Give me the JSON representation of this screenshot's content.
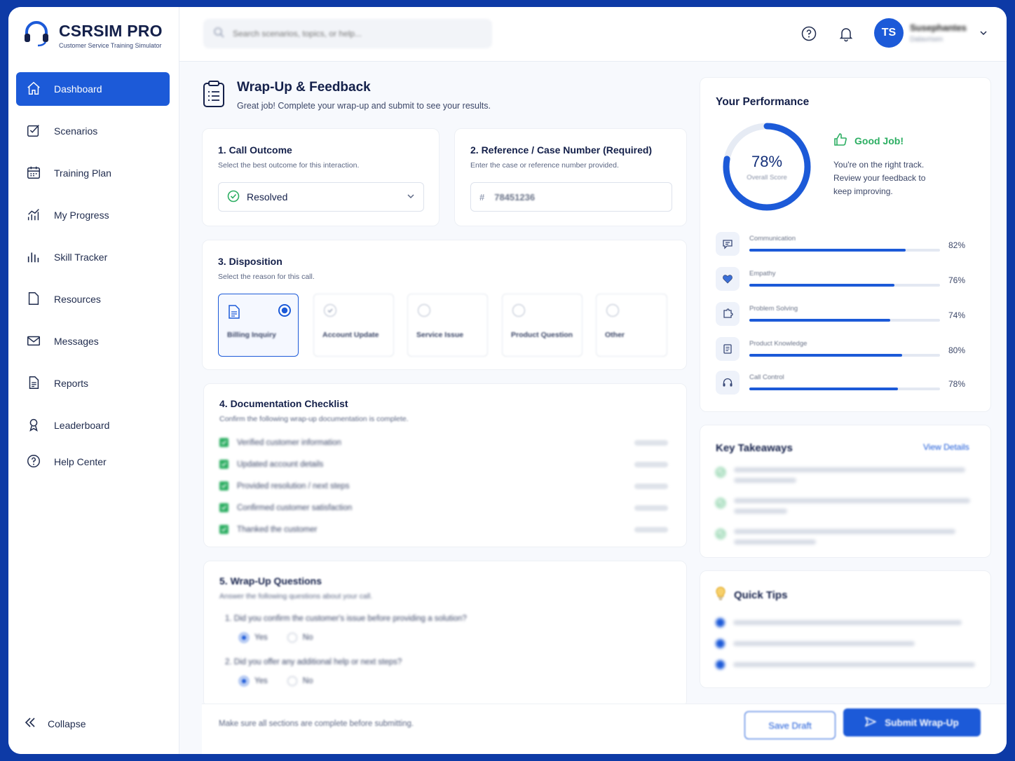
{
  "app": {
    "brand_title": "CSRSIM PRO",
    "brand_subtitle": "Customer Service Training Simulator"
  },
  "sidebar": {
    "items": [
      {
        "label": "Dashboard",
        "icon": "home-icon",
        "active": true
      },
      {
        "label": "Scenarios",
        "icon": "scenarios-icon"
      },
      {
        "label": "Training Plan",
        "icon": "calendar-icon"
      },
      {
        "label": "My Progress",
        "icon": "progress-icon"
      },
      {
        "label": "Skill Tracker",
        "icon": "bar-chart-icon"
      },
      {
        "label": "Resources",
        "icon": "folder-icon"
      },
      {
        "label": "Messages",
        "icon": "mail-icon"
      },
      {
        "label": "Reports",
        "icon": "report-icon"
      },
      {
        "label": "Leaderboard",
        "icon": "trophy-icon"
      },
      {
        "label": "Help Center",
        "icon": "help-icon"
      }
    ],
    "collapse_label": "Collapse"
  },
  "topbar": {
    "search_placeholder": "Search scenarios, topics, or help...",
    "avatar_initials": "TS",
    "user_name": "Susephantes",
    "user_role": "Dalavrisen"
  },
  "page": {
    "title": "Wrap-Up & Feedback",
    "subtitle": "Great job! Complete your wrap-up and submit to see your results."
  },
  "call_outcome": {
    "title": "1. Call Outcome",
    "hint": "Select the best outcome for this interaction.",
    "selected": "Resolved"
  },
  "reference": {
    "title": "2. Reference / Case Number (Required)",
    "hint": "Enter the case or reference number provided.",
    "value": "78451236"
  },
  "disposition": {
    "title": "3. Disposition",
    "hint": "Select the reason for this call.",
    "options": [
      {
        "label": "Billing Inquiry",
        "selected": true
      },
      {
        "label": "Account Update"
      },
      {
        "label": "Service Issue"
      },
      {
        "label": "Product Question"
      },
      {
        "label": "Other"
      }
    ]
  },
  "checklist": {
    "title": "4. Documentation Checklist",
    "hint": "Confirm the following wrap-up documentation is complete.",
    "items": [
      "Verified customer information",
      "Updated account details",
      "Provided resolution / next steps",
      "Confirmed customer satisfaction",
      "Thanked the customer"
    ]
  },
  "questions": {
    "title": "5. Wrap-Up Questions",
    "hint": "Answer the following questions about your call.",
    "items": [
      {
        "text": "1.  Did you confirm the customer's issue before providing a solution?",
        "yes": "Yes",
        "no": "No",
        "answer": "Yes"
      },
      {
        "text": "2.  Did you offer any additional help or next steps?",
        "yes": "Yes",
        "no": "No",
        "answer": "Yes"
      }
    ]
  },
  "footer": {
    "note": "Make sure all sections are complete before submitting.",
    "save_label": "Save Draft",
    "submit_label": "Submit Wrap-Up"
  },
  "performance": {
    "title": "Your Performance",
    "overall_pct": "78%",
    "overall_value": 0.78,
    "overall_label": "Overall Score",
    "good_title": "Good Job!",
    "good_text": "You're on the right track. Review your feedback to keep improving.",
    "skills": [
      {
        "name": "Communication",
        "pct": "82%",
        "value": 0.82,
        "icon": "chat-icon"
      },
      {
        "name": "Empathy",
        "pct": "76%",
        "value": 0.76,
        "icon": "heart-icon"
      },
      {
        "name": "Problem Solving",
        "pct": "74%",
        "value": 0.74,
        "icon": "puzzle-icon"
      },
      {
        "name": "Product Knowledge",
        "pct": "80%",
        "value": 0.8,
        "icon": "book-icon"
      },
      {
        "name": "Call Control",
        "pct": "78%",
        "value": 0.78,
        "icon": "headset-icon"
      }
    ]
  },
  "takeaways": {
    "title": "Key Takeaways",
    "link": "View Details"
  },
  "tips": {
    "title": "Quick Tips"
  },
  "colors": {
    "accent": "#1c5ad8",
    "success": "#2cae62",
    "frame": "#0d3aa6"
  }
}
